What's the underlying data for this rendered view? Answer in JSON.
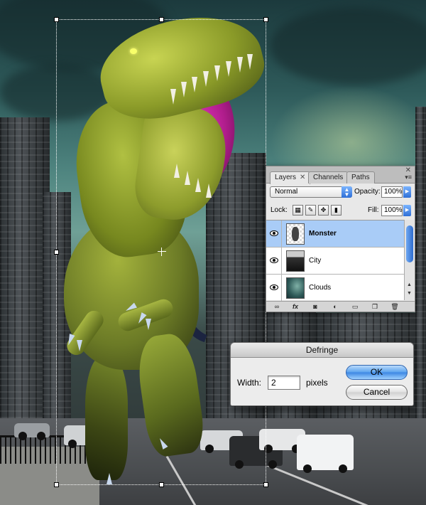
{
  "canvas": {
    "layers_visible": [
      "Monster",
      "City",
      "Clouds"
    ]
  },
  "layers_panel": {
    "tabs": [
      {
        "label": "Layers",
        "active": true
      },
      {
        "label": "Channels",
        "active": false
      },
      {
        "label": "Paths",
        "active": false
      }
    ],
    "tab_close_glyph": "✕",
    "panel_close_glyph": "✕",
    "panel_menu_glyph": "▾≡",
    "blend_mode": "Normal",
    "opacity_label": "Opacity:",
    "opacity_value": "100%",
    "lock_label": "Lock:",
    "fill_label": "Fill:",
    "fill_value": "100%",
    "layers": [
      {
        "name": "Monster",
        "selected": true,
        "visible": true
      },
      {
        "name": "City",
        "selected": false,
        "visible": true
      },
      {
        "name": "Clouds",
        "selected": false,
        "visible": true
      }
    ],
    "footer_icons": [
      "link-icon",
      "fx-icon",
      "mask-icon",
      "adjustment-icon",
      "group-icon",
      "new-layer-icon",
      "trash-icon"
    ],
    "fx_label": "fx"
  },
  "defringe_dialog": {
    "title": "Defringe",
    "width_label": "Width:",
    "width_value": "2",
    "unit_label": "pixels",
    "ok_label": "OK",
    "cancel_label": "Cancel"
  },
  "colors": {
    "selected_layer": "#a9ccf7",
    "accent_blue": "#3b86e3",
    "dino_mouth": "#f03cc8"
  }
}
